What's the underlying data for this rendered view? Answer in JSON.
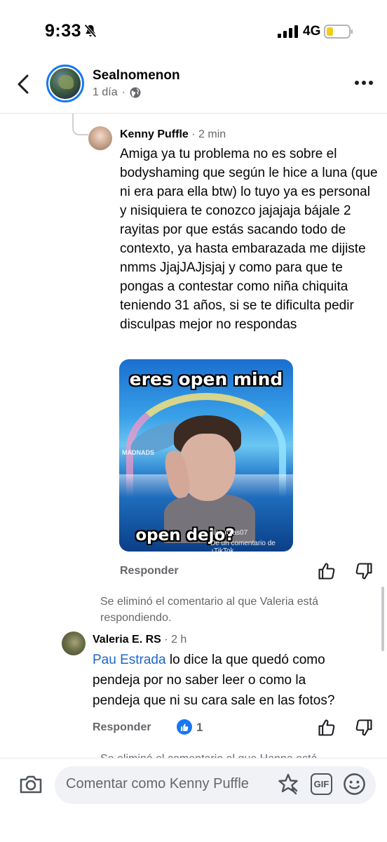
{
  "status_bar": {
    "time": "9:33",
    "network": "4G",
    "icons": [
      "bell-slash-icon",
      "signal-bars-icon",
      "battery-low-icon"
    ],
    "battery_color": "#f2cc1b"
  },
  "header": {
    "page_name": "Sealnomenon",
    "post_age": "1 día",
    "icons": [
      "back-chevron-icon",
      "globe-icon",
      "more-dots-icon"
    ]
  },
  "comments": [
    {
      "author": "Kenny Puffle",
      "time": "· 2 min",
      "text": "Amiga ya tu problema no es sobre el bodyshaming que según le hice a luna (que ni era para ella btw) lo tuyo ya es personal y nisiquiera te conozco jajajaja bájale 2 rayitas por que estás sacando todo de contexto, ya hasta embarazada me dijiste nmms JjajJAJjsjaj y como para que te pongas a contestar como niña chiquita teniendo 31 años, si se te dificulta pedir disculpas mejor no respondas",
      "gif": {
        "top_caption": "eres open mind",
        "bottom_caption": "open dejo?",
        "watermark": "MADNADS",
        "credit_user": "lina.rojas07",
        "credit_source": "De un comentario de ♪TikTok"
      },
      "reply_label": "Responder"
    },
    {
      "deleted_note": "Se eliminó el comentario al que Valeria está respondiendo.",
      "author": "Valeria E. RS",
      "time": "· 2 h",
      "mention": "Pau Estrada",
      "text_lines": [
        " lo dice la que quedó como",
        "pendeja por no saber leer o como la",
        "pendeja que ni su cara sale en las fotos?"
      ],
      "reply_label": "Responder",
      "like_count": "1"
    }
  ],
  "partial_note": "Se eliminó el comentario al que Hanna está",
  "composer": {
    "placeholder": "Comentar como Kenny Puffle",
    "gif_label": "GIF"
  },
  "colors": {
    "accent": "#1877f2",
    "mention": "#1b66c9",
    "muted": "#65676b"
  }
}
